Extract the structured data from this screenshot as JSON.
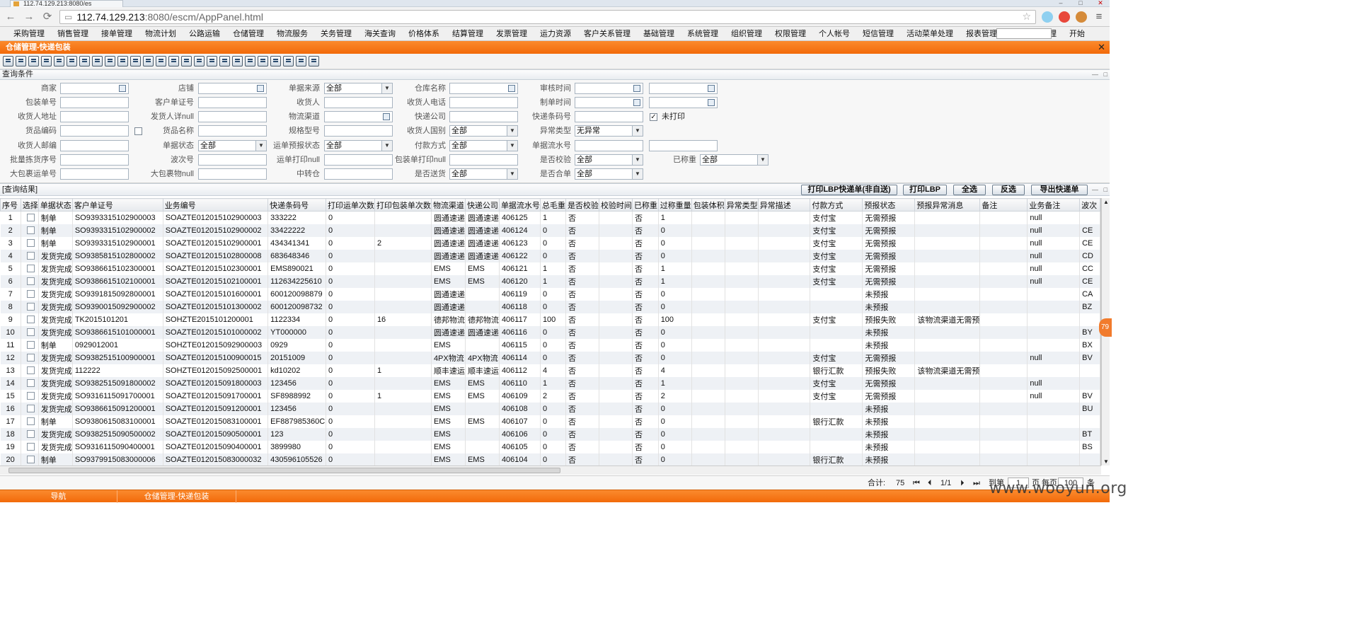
{
  "browser": {
    "tab_title": "112.74.129.213:8080/es",
    "url_host": "112.74.129.213",
    "url_rest": ":8080/escm/AppPanel.html"
  },
  "menu": [
    "采购管理",
    "销售管理",
    "接单管理",
    "物流计划",
    "公路运输",
    "仓储管理",
    "物流服务",
    "关务管理",
    "海关查询",
    "价格体系",
    "结算管理",
    "发票管理",
    "运力资源",
    "客户关系管理",
    "基础管理",
    "系统管理",
    "组织管理",
    "权限管理",
    "个人帐号",
    "短信管理",
    "活动菜单处理",
    "报表管理",
    "本地菜单管理",
    "开始"
  ],
  "window_title": "仓储管理-快递包装",
  "query_title": "查询条件",
  "result_title": "[查询结果]",
  "form": {
    "merchant": "商家",
    "shop": "店铺",
    "source": "单据来源",
    "source_val": "全部",
    "warehouse": "仓库名称",
    "audit_time": "审核时间",
    "pack_no": "包装单号",
    "cust_no": "客户单证号",
    "receiver": "收货人",
    "receiver_phone": "收货人电话",
    "create_time": "制单时间",
    "receiver_addr": "收货人地址",
    "receiver_detail": "发货人详null",
    "channel": "物流渠道",
    "express_co": "快递公司",
    "express_code": "快递条码号",
    "not_printed": "未打印",
    "goods_code": "货品编码",
    "goods_name": "货品名称",
    "spec": "规格型号",
    "country": "收货人国别",
    "country_val": "全部",
    "abn_type": "异常类型",
    "abn_type_val": "无异常",
    "zip": "收货人邮编",
    "status": "单据状态",
    "status_val": "全部",
    "prereport": "运单预报状态",
    "prereport_val": "全部",
    "payment": "付款方式",
    "payment_val": "全部",
    "flow_no": "单据流水号",
    "batch": "批量拣货序号",
    "wave": "波次号",
    "print_null": "运单打印null",
    "pack_print_null": "包装单打印null",
    "verified": "是否校验",
    "verified_val": "全部",
    "weighed": "已称重",
    "weighed_val": "全部",
    "bigpack": "大包裹运单号",
    "bigpack_null": "大包裹物null",
    "transit": "中转仓",
    "delivered": "是否送货",
    "delivered_val": "全部",
    "merged": "是否合单",
    "merged_val": "全部"
  },
  "buttons": {
    "print_lbp_self": "打印LBP快递单(非自送)",
    "print_lbp": "打印LBP",
    "select_all": "全选",
    "invert": "反选",
    "export": "导出快递单"
  },
  "columns": [
    "序号",
    "选择",
    "单据状态",
    "客户单证号",
    "业务编号",
    "快递条码号",
    "打印运单次数",
    "打印包装单次数",
    "物流渠道",
    "快递公司",
    "单据流水号",
    "总毛重",
    "是否校验",
    "校验时间",
    "已称重",
    "过称重量",
    "包装体积",
    "异常类型",
    "异常描述",
    "付款方式",
    "预报状态",
    "预报异常消息",
    "备注",
    "业务备注",
    "波次"
  ],
  "rows": [
    [
      "1",
      "",
      "制单",
      "SO9393315102900003",
      "SOAZTE012015102900003",
      "333222",
      "0",
      "",
      "圆通速递",
      "圆通速递",
      "406125",
      "1",
      "否",
      "",
      "否",
      "1",
      "",
      "",
      "",
      "支付宝",
      "无需预报",
      "",
      "",
      "null",
      ""
    ],
    [
      "2",
      "",
      "制单",
      "SO9393315102900002",
      "SOAZTE012015102900002",
      "33422222",
      "0",
      "",
      "圆通速递",
      "圆通速递",
      "406124",
      "0",
      "否",
      "",
      "否",
      "0",
      "",
      "",
      "",
      "支付宝",
      "无需预报",
      "",
      "",
      "null",
      "CE"
    ],
    [
      "3",
      "",
      "制单",
      "SO9393315102900001",
      "SOAZTE012015102900001",
      "434341341",
      "0",
      "2",
      "圆通速递",
      "圆通速递",
      "406123",
      "0",
      "否",
      "",
      "否",
      "0",
      "",
      "",
      "",
      "支付宝",
      "无需预报",
      "",
      "",
      "null",
      "CE"
    ],
    [
      "4",
      "",
      "发货完成",
      "SO9385815102800002",
      "SOAZTE012015102800008",
      "683648346",
      "0",
      "",
      "圆通速递",
      "圆通速递",
      "406122",
      "0",
      "否",
      "",
      "否",
      "0",
      "",
      "",
      "",
      "支付宝",
      "无需预报",
      "",
      "",
      "null",
      "CD"
    ],
    [
      "5",
      "",
      "发货完成",
      "SO9386615102300001",
      "SOAZTE012015102300001",
      "EMS890021",
      "0",
      "",
      "EMS",
      "EMS",
      "406121",
      "1",
      "否",
      "",
      "否",
      "1",
      "",
      "",
      "",
      "支付宝",
      "无需预报",
      "",
      "",
      "null",
      "CC"
    ],
    [
      "6",
      "",
      "发货完成",
      "SO9386615102100001",
      "SOAZTE012015102100001",
      "112634225610",
      "0",
      "",
      "EMS",
      "EMS",
      "406120",
      "1",
      "否",
      "",
      "否",
      "1",
      "",
      "",
      "",
      "支付宝",
      "无需预报",
      "",
      "",
      "null",
      "CE"
    ],
    [
      "7",
      "",
      "发货完成",
      "SO9391815092800001",
      "SOAZTE012015101600001",
      "600120098879",
      "0",
      "",
      "圆通速递",
      "",
      "406119",
      "0",
      "否",
      "",
      "否",
      "0",
      "",
      "",
      "",
      "",
      "未预报",
      "",
      "",
      "",
      "CA"
    ],
    [
      "8",
      "",
      "发货完成",
      "SO9390015092900002",
      "SOAZTE012015101300002",
      "600120098732",
      "0",
      "",
      "圆通速递",
      "",
      "406118",
      "0",
      "否",
      "",
      "否",
      "0",
      "",
      "",
      "",
      "",
      "未预报",
      "",
      "",
      "",
      "BZ"
    ],
    [
      "9",
      "",
      "发货完成",
      "TK2015101201",
      "SOHZTE2015101200001",
      "1122334",
      "0",
      "16",
      "德邦物流",
      "德邦物流",
      "406117",
      "100",
      "否",
      "",
      "否",
      "100",
      "",
      "",
      "",
      "支付宝",
      "预报失败",
      "该物流渠道无需预",
      "",
      "",
      ""
    ],
    [
      "10",
      "",
      "发货完成",
      "SO9386615101000001",
      "SOAZTE012015101000002",
      "YT000000",
      "0",
      "",
      "圆通速递",
      "圆通速递",
      "406116",
      "0",
      "否",
      "",
      "否",
      "0",
      "",
      "",
      "",
      "",
      "未预报",
      "",
      "",
      "",
      "BY"
    ],
    [
      "11",
      "",
      "制单",
      "0929012001",
      "SOHZTE012015092900003",
      "0929",
      "0",
      "",
      "EMS",
      "",
      "406115",
      "0",
      "否",
      "",
      "否",
      "0",
      "",
      "",
      "",
      "",
      "未预报",
      "",
      "",
      "",
      "BX"
    ],
    [
      "12",
      "",
      "发货完成",
      "SO9382515100900001",
      "SOAZTE012015100900015",
      "20151009",
      "0",
      "",
      "4PX物流",
      "4PX物流",
      "406114",
      "0",
      "否",
      "",
      "否",
      "0",
      "",
      "",
      "",
      "支付宝",
      "无需预报",
      "",
      "",
      "null",
      "BV"
    ],
    [
      "13",
      "",
      "发货完成",
      "112222",
      "SOHZTE012015092500001",
      "kd10202",
      "0",
      "1",
      "顺丰速运",
      "顺丰速运",
      "406112",
      "4",
      "否",
      "",
      "否",
      "4",
      "",
      "",
      "",
      "银行汇款",
      "预报失败",
      "该物流渠道无需预",
      "",
      "",
      ""
    ],
    [
      "14",
      "",
      "发货完成",
      "SO9382515091800002",
      "SOAZTE012015091800003",
      "123456",
      "0",
      "",
      "EMS",
      "EMS",
      "406110",
      "1",
      "否",
      "",
      "否",
      "1",
      "",
      "",
      "",
      "支付宝",
      "无需预报",
      "",
      "",
      "null",
      ""
    ],
    [
      "15",
      "",
      "发货完成",
      "SO9316115091700001",
      "SOAZTE012015091700001",
      "SF8988992",
      "0",
      "1",
      "EMS",
      "EMS",
      "406109",
      "2",
      "否",
      "",
      "否",
      "2",
      "",
      "",
      "",
      "支付宝",
      "无需预报",
      "",
      "",
      "null",
      "BV"
    ],
    [
      "16",
      "",
      "发货完成",
      "SO9386615091200001",
      "SOAZTE012015091200001",
      "123456",
      "0",
      "",
      "EMS",
      "",
      "406108",
      "0",
      "否",
      "",
      "否",
      "0",
      "",
      "",
      "",
      "",
      "未预报",
      "",
      "",
      "",
      "BU"
    ],
    [
      "17",
      "",
      "制单",
      "SO9380615083100001",
      "SOAZTE012015083100001",
      "EF887985360C",
      "0",
      "",
      "EMS",
      "EMS",
      "406107",
      "0",
      "否",
      "",
      "否",
      "0",
      "",
      "",
      "",
      "银行汇款",
      "未预报",
      "",
      "",
      "",
      ""
    ],
    [
      "18",
      "",
      "发货完成",
      "SO9382515090500002",
      "SOAZTE012015090500001",
      "123",
      "0",
      "",
      "EMS",
      "",
      "406106",
      "0",
      "否",
      "",
      "否",
      "0",
      "",
      "",
      "",
      "",
      "未预报",
      "",
      "",
      "",
      "BT"
    ],
    [
      "19",
      "",
      "发货完成",
      "SO9316115090400001",
      "SOAZTE012015090400001",
      "3899980",
      "0",
      "",
      "EMS",
      "",
      "406105",
      "0",
      "否",
      "",
      "否",
      "0",
      "",
      "",
      "",
      "",
      "未预报",
      "",
      "",
      "",
      "BS"
    ],
    [
      "20",
      "",
      "制单",
      "SO9379915083000006",
      "SOAZTE012015083000032",
      "430596105526",
      "0",
      "",
      "EMS",
      "EMS",
      "406104",
      "0",
      "否",
      "",
      "否",
      "0",
      "",
      "",
      "",
      "银行汇款",
      "未预报",
      "",
      "",
      "",
      ""
    ]
  ],
  "pager": {
    "total_label": "合计:",
    "total": "75",
    "page": "1/1",
    "goto": "到第",
    "goto_val": "1",
    "per_page": "页 每页",
    "per_page_val": "100",
    "unit": "条"
  },
  "bottom_tabs": [
    "导航",
    "仓储管理-快递包装"
  ],
  "watermark": "www.wooyun.org",
  "badge": "79"
}
